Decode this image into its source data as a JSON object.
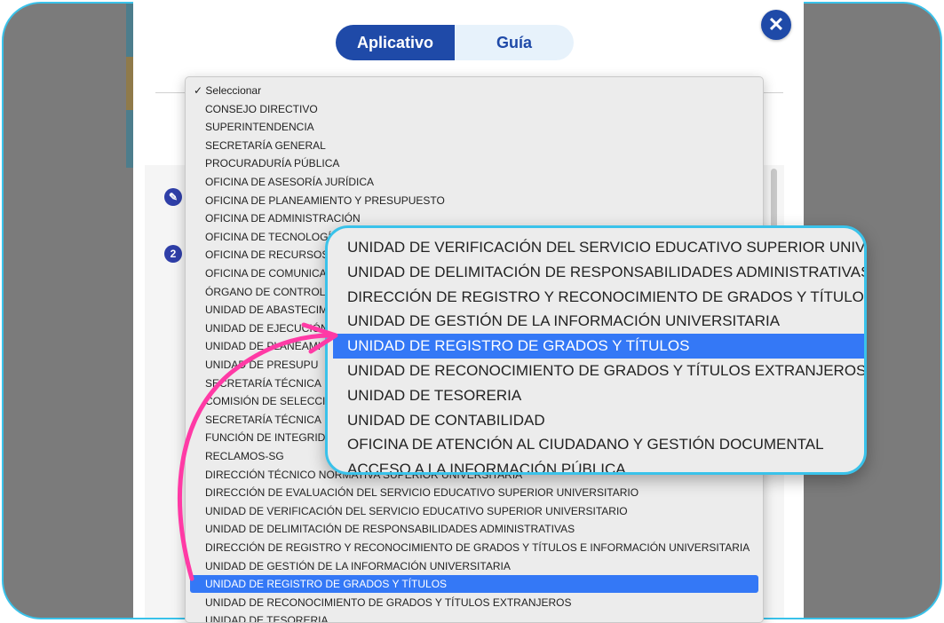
{
  "tabs": {
    "active": "Aplicativo",
    "other": "Guía"
  },
  "close_icon": "close-icon",
  "steps": [
    "",
    "2"
  ],
  "dropdown": {
    "options": [
      "✓ Seleccionar",
      "CONSEJO DIRECTIVO",
      "SUPERINTENDENCIA",
      "SECRETARÍA GENERAL",
      "PROCURADURÍA PÚBLICA",
      "OFICINA DE ASESORÍA JURÍDICA",
      "OFICINA DE PLANEAMIENTO Y PRESUPUESTO",
      "OFICINA DE ADMINISTRACIÓN",
      "OFICINA DE TECNOLOGÍAS",
      "OFICINA DE RECURSOS",
      "OFICINA DE COMUNICA",
      "ÓRGANO DE CONTROL",
      "UNIDAD DE ABASTECIM",
      "UNIDAD DE EJECUCIÓN",
      "UNIDAD DE PLANEAMI",
      "UNIDAD DE PRESUPU",
      "SECRETARÍA TÉCNICA",
      "COMISIÓN DE SELECCI",
      "SECRETARÍA TÉCNICA",
      "FUNCIÓN DE INTEGRID",
      "RECLAMOS-SG",
      "DIRECCIÓN TÉCNICO NORMATIVA SUPERIOR UNIVERSITARIA",
      "DIRECCIÓN DE EVALUACIÓN DEL SERVICIO EDUCATIVO SUPERIOR UNIVERSITARIO",
      "UNIDAD DE VERIFICACIÓN DEL SERVICIO EDUCATIVO SUPERIOR UNIVERSITARIO",
      "UNIDAD DE DELIMITACIÓN DE RESPONSABILIDADES ADMINISTRATIVAS",
      "DIRECCIÓN DE REGISTRO Y RECONOCIMIENTO DE GRADOS Y TÍTULOS E INFORMACIÓN UNIVERSITARIA",
      "UNIDAD DE GESTIÓN DE LA INFORMACIÓN UNIVERSITARIA",
      "UNIDAD DE REGISTRO DE GRADOS Y TÍTULOS",
      "UNIDAD DE RECONOCIMIENTO DE GRADOS Y TÍTULOS EXTRANJEROS",
      "UNIDAD DE TESORERIA"
    ],
    "selected_index": 27
  },
  "zoom": {
    "options": [
      "UNIDAD DE VERIFICACIÓN DEL SERVICIO EDUCATIVO SUPERIOR UNIVE",
      "UNIDAD DE DELIMITACIÓN DE RESPONSABILIDADES ADMINISTRATIVAS",
      "DIRECCIÓN DE REGISTRO Y RECONOCIMIENTO DE GRADOS Y TÍTULOS E",
      "UNIDAD DE GESTIÓN DE LA INFORMACIÓN UNIVERSITARIA",
      "UNIDAD DE REGISTRO DE GRADOS Y TÍTULOS",
      "UNIDAD DE RECONOCIMIENTO DE GRADOS Y TÍTULOS EXTRANJEROS",
      "UNIDAD DE TESORERIA",
      "UNIDAD DE CONTABILIDAD",
      "OFICINA DE ATENCIÓN AL CIUDADANO Y GESTIÓN DOCUMENTAL",
      "ACCESO A LA INFORMACIÓN PÚBLICA"
    ],
    "selected_index": 4
  },
  "colors": {
    "accent": "#1f4aa8",
    "highlight": "#3478f6",
    "callout": "#39c2ea",
    "arrow": "#ff3aa5"
  }
}
